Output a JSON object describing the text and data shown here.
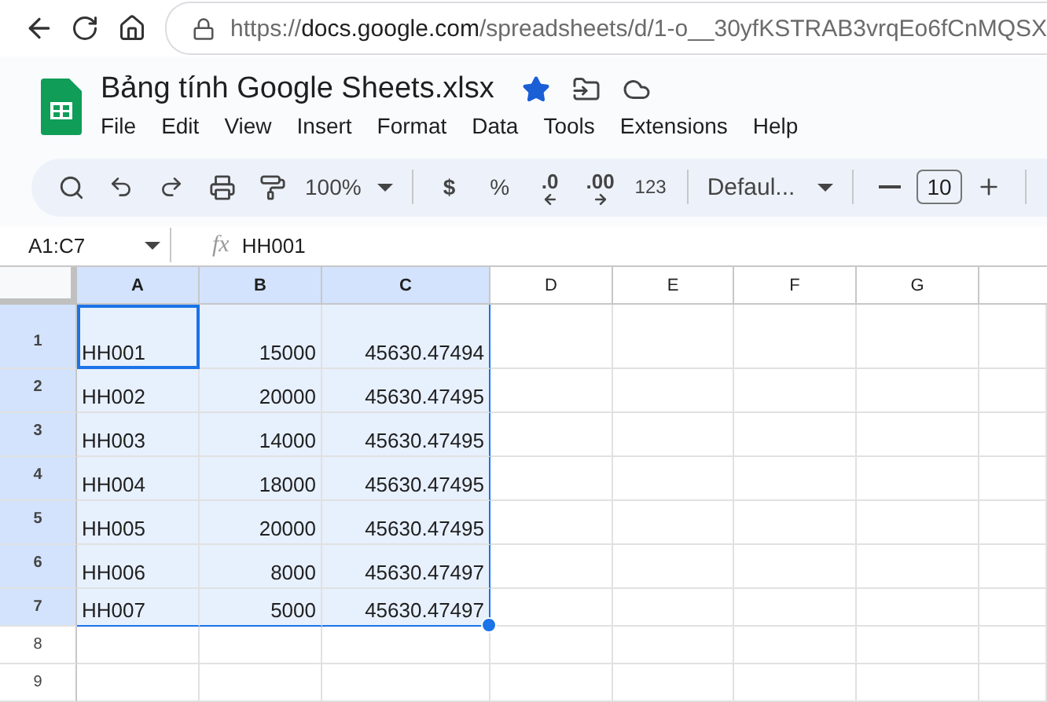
{
  "browser": {
    "url": {
      "scheme": "https://",
      "host": "docs.google.com",
      "path": "/spreadsheets/d/1-o__30yfKSTRAB3vrqEo6fCnMQSX"
    }
  },
  "document": {
    "title": "Bảng tính Google Sheets.xlsx",
    "starred": true
  },
  "menu": [
    "File",
    "Edit",
    "View",
    "Insert",
    "Format",
    "Data",
    "Tools",
    "Extensions",
    "Help"
  ],
  "toolbar": {
    "zoom": "100%",
    "currency": "$",
    "percent": "%",
    "decrease_decimal": ".0",
    "increase_decimal": ".00",
    "number_format": "123",
    "font": "Defaul...",
    "font_size": "10"
  },
  "formula_bar": {
    "range": "A1:C7",
    "fx": "fx",
    "value": "HH001"
  },
  "columns": [
    {
      "label": "A",
      "selected": true
    },
    {
      "label": "B",
      "selected": true
    },
    {
      "label": "C",
      "selected": true
    },
    {
      "label": "D",
      "selected": false
    },
    {
      "label": "E",
      "selected": false
    },
    {
      "label": "F",
      "selected": false
    },
    {
      "label": "G",
      "selected": false
    }
  ],
  "rows": [
    {
      "label": "1",
      "selected": true,
      "kind": "tall",
      "cells": [
        "HH001",
        "15000",
        "45630.47494"
      ]
    },
    {
      "label": "2",
      "selected": true,
      "kind": "normal",
      "cells": [
        "HH002",
        "20000",
        "45630.47495"
      ]
    },
    {
      "label": "3",
      "selected": true,
      "kind": "normal",
      "cells": [
        "HH003",
        "14000",
        "45630.47495"
      ]
    },
    {
      "label": "4",
      "selected": true,
      "kind": "normal",
      "cells": [
        "HH004",
        "18000",
        "45630.47495"
      ]
    },
    {
      "label": "5",
      "selected": true,
      "kind": "normal",
      "cells": [
        "HH005",
        "20000",
        "45630.47495"
      ]
    },
    {
      "label": "6",
      "selected": true,
      "kind": "normal",
      "cells": [
        "HH006",
        "8000",
        "45630.47497"
      ]
    },
    {
      "label": "7",
      "selected": true,
      "kind": "short",
      "cells": [
        "HH007",
        "5000",
        "45630.47497"
      ]
    },
    {
      "label": "8",
      "selected": false,
      "kind": "short",
      "cells": []
    },
    {
      "label": "9",
      "selected": false,
      "kind": "short",
      "cells": []
    }
  ]
}
